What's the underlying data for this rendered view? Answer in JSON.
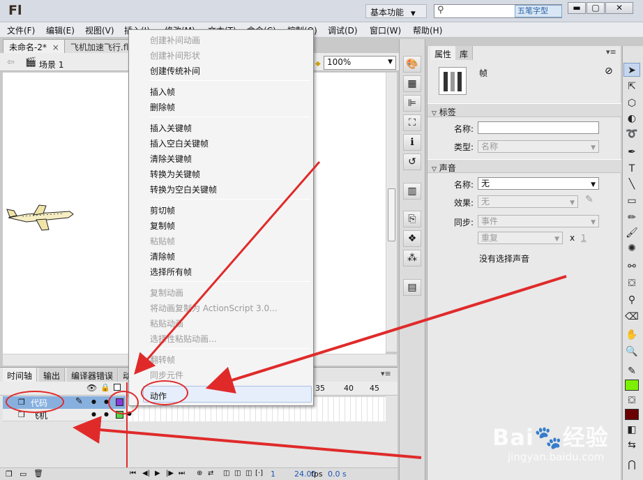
{
  "app": {
    "logo": "Fl",
    "workspace": "基本功能",
    "watermark_tag": "五笔字型"
  },
  "window_buttons": {
    "minimize": "▬",
    "maximize": "▢",
    "close": "✕"
  },
  "menubar": [
    "文件(F)",
    "编辑(E)",
    "视图(V)",
    "插入(I)",
    "修改(M)",
    "文本(T)",
    "命令(C)",
    "控制(O)",
    "调试(D)",
    "窗口(W)",
    "帮助(H)"
  ],
  "doc_tabs": {
    "active": "未命名-2*",
    "active_close": "×",
    "other": "飞机加速飞行.fl"
  },
  "editbar": {
    "scene": "场景 1",
    "zoom": "100%"
  },
  "timeline": {
    "tabs": [
      "时间轴",
      "输出",
      "编译器错误",
      "动"
    ],
    "frame_numbers": [
      "35",
      "40",
      "45"
    ],
    "layers": [
      "代码",
      "飞机"
    ],
    "fps": "24.00",
    "fps_unit": "fps",
    "time": "0.0 s",
    "frame": "1"
  },
  "context_menu": {
    "items": [
      {
        "label": "创建补间动画",
        "disabled": true
      },
      {
        "label": "创建补间形状",
        "disabled": true
      },
      {
        "label": "创建传统补间",
        "disabled": false
      },
      {
        "label": "插入帧",
        "disabled": false
      },
      {
        "label": "删除帧",
        "disabled": false
      },
      {
        "label": "插入关键帧",
        "disabled": false
      },
      {
        "label": "插入空白关键帧",
        "disabled": false
      },
      {
        "label": "清除关键帧",
        "disabled": false
      },
      {
        "label": "转换为关键帧",
        "disabled": false
      },
      {
        "label": "转换为空白关键帧",
        "disabled": false
      },
      {
        "label": "剪切帧",
        "disabled": false
      },
      {
        "label": "复制帧",
        "disabled": false
      },
      {
        "label": "粘贴帧",
        "disabled": true
      },
      {
        "label": "清除帧",
        "disabled": false
      },
      {
        "label": "选择所有帧",
        "disabled": false
      },
      {
        "label": "复制动画",
        "disabled": true
      },
      {
        "label": "将动画复制为 ActionScript 3.0...",
        "disabled": true
      },
      {
        "label": "粘贴动画",
        "disabled": true
      },
      {
        "label": "选择性粘贴动画...",
        "disabled": true
      },
      {
        "label": "翻转帧",
        "disabled": true
      },
      {
        "label": "同步元件",
        "disabled": true
      },
      {
        "label": "动作",
        "disabled": false,
        "highlighted": true
      }
    ]
  },
  "properties": {
    "tabs": [
      "属性",
      "库"
    ],
    "type_label": "帧",
    "label_section": "标签",
    "name_label": "名称:",
    "type_field_label": "类型:",
    "type_value": "名称",
    "sound_section": "声音",
    "sound_name_value": "无",
    "effect_label": "效果:",
    "effect_value": "无",
    "sync_label": "同步:",
    "sync_value": "事件",
    "repeat_value": "重复",
    "repeat_x": "x",
    "repeat_count": "1",
    "no_sound": "没有选择声音"
  },
  "watermark": {
    "brand": "Bai",
    "brand_cn": "经验",
    "url": "jingyan.baidu.com"
  },
  "colors": {
    "stroke": "#7cf000",
    "fill": "#6a0000",
    "annotation": "#e02a2a",
    "layer_selected": "#87b0df"
  }
}
